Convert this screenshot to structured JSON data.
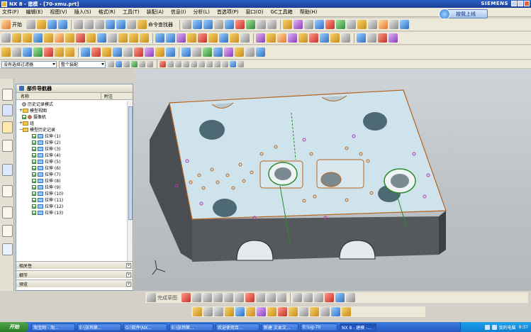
{
  "window": {
    "title": "NX 8 - 建模 - [70-xmu.prt]",
    "brand": "SIEMENS"
  },
  "menu": {
    "items": [
      "文件(F)",
      "编辑(E)",
      "视图(V)",
      "插入(S)",
      "格式(R)",
      "工具(T)",
      "装配(A)",
      "信息(I)",
      "分析(L)",
      "首选项(P)",
      "窗口(O)",
      "GC工具箱",
      "帮助(H)"
    ]
  },
  "help_button": {
    "label": "按我上线"
  },
  "toolbar": {
    "start_label": "开始",
    "command_finder_label": "命令查找器",
    "selection_filter": "没有选择过滤器",
    "selection_scope": "整个装配"
  },
  "navigator": {
    "title": "部件导航器",
    "col_name": "名称",
    "col_note": "附注",
    "nodes": [
      {
        "label": "历史记录模式",
        "icon": "history-icon"
      },
      {
        "label": "模型视图",
        "icon": "views-folder-icon"
      },
      {
        "label": "摄像机",
        "icon": "camera-icon"
      },
      {
        "label": "组",
        "icon": "group-folder-icon"
      },
      {
        "label": "模型历史记录",
        "icon": "history-folder-icon"
      },
      {
        "label": "拉伸 (1)"
      },
      {
        "label": "拉伸 (2)"
      },
      {
        "label": "拉伸 (3)"
      },
      {
        "label": "拉伸 (4)"
      },
      {
        "label": "拉伸 (5)"
      },
      {
        "label": "拉伸 (6)"
      },
      {
        "label": "拉伸 (7)"
      },
      {
        "label": "拉伸 (8)"
      },
      {
        "label": "拉伸 (9)"
      },
      {
        "label": "拉伸 (10)"
      },
      {
        "label": "拉伸 (11)"
      },
      {
        "label": "拉伸 (12)"
      },
      {
        "label": "拉伸 (13)"
      }
    ],
    "sections": [
      "相关性",
      "细节",
      "预览"
    ]
  },
  "bottom_toolbar": {
    "sketch_label": "完成草图"
  },
  "taskbar": {
    "start_label": "开始",
    "tasks": [
      "淘宝网 - 淘...",
      "E:\\张玮第...",
      "G:\\软件\\NX...",
      "E:\\张玮第...",
      "欢迎使用百...",
      "新建 文本文...",
      "E:\\ug-70",
      "NX 8 - 建模 -..."
    ],
    "tray_label": "我的电脑",
    "clock": "9:37"
  }
}
